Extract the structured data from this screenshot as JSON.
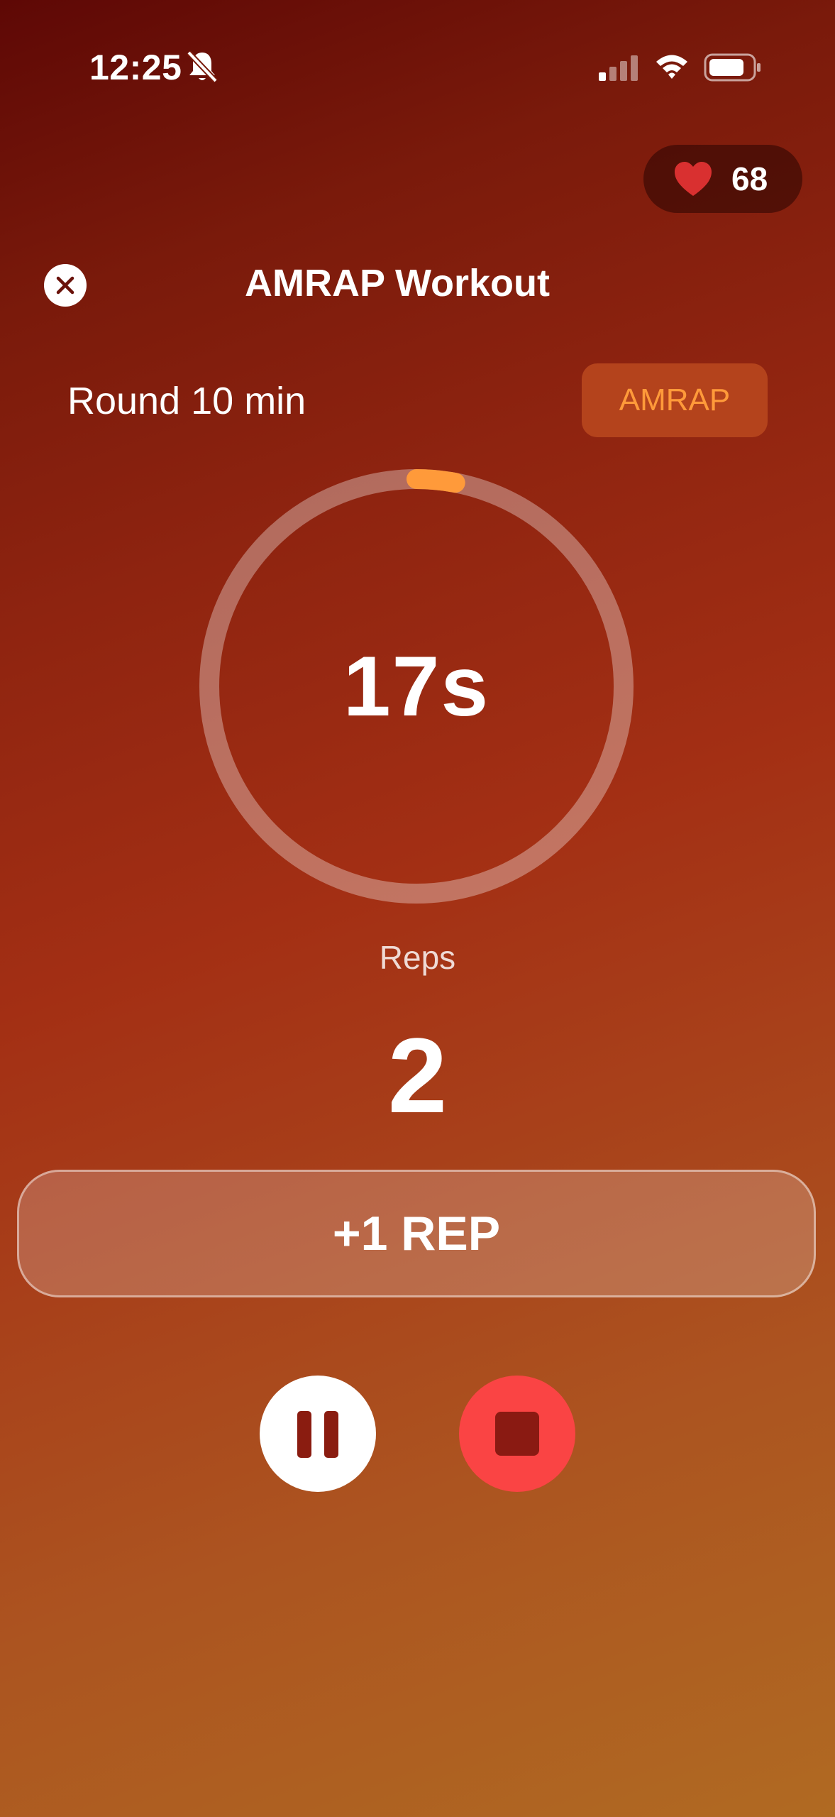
{
  "status_bar": {
    "time": "12:25",
    "icons": [
      "bell-slash-icon",
      "cellular-signal-icon",
      "wifi-icon",
      "battery-icon"
    ]
  },
  "heart_rate": {
    "value": "68",
    "icon": "heart-icon",
    "color": "#d93030"
  },
  "header": {
    "title": "AMRAP Workout",
    "close_icon": "close-icon"
  },
  "round": {
    "label": "Round 10 min",
    "mode": "AMRAP"
  },
  "timer": {
    "display": "17s",
    "progress": 0.03
  },
  "reps": {
    "label": "Reps",
    "value": "2"
  },
  "actions": {
    "add_rep_label": "+1 REP"
  },
  "controls": {
    "pause_icon": "pause-icon",
    "stop_icon": "stop-icon"
  },
  "colors": {
    "accent": "#ff9a3a",
    "stop": "#fa4444",
    "background_top": "#5e0805",
    "background_bottom": "#b06a22"
  }
}
